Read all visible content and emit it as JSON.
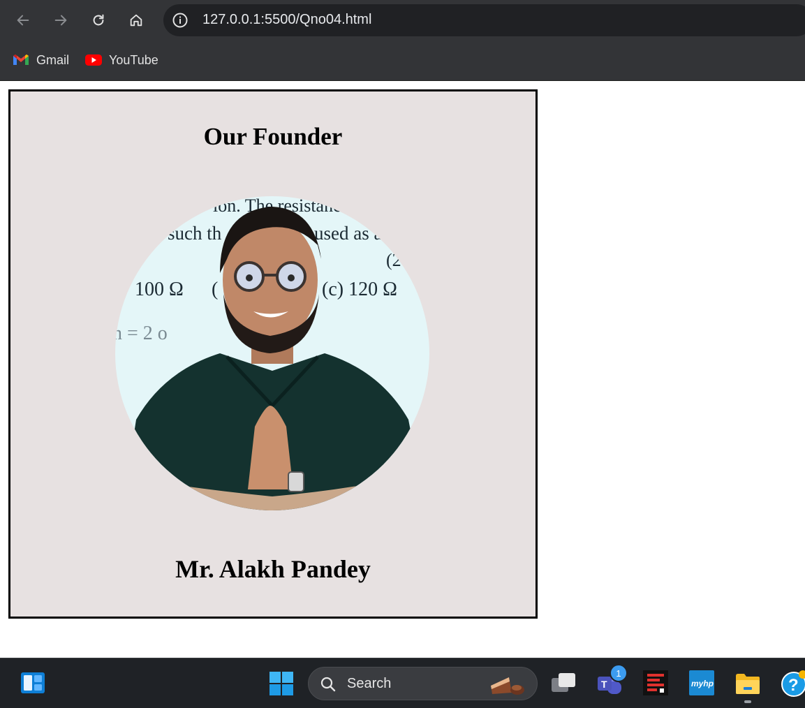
{
  "browser": {
    "url": "127.0.0.1:5500/Qno04.html",
    "bookmarks": [
      {
        "label": "Gmail",
        "icon": "gmail-icon"
      },
      {
        "label": "YouTube",
        "icon": "youtube-icon"
      }
    ]
  },
  "page": {
    "title": "Our Founder",
    "name": "Mr. Alakh Pandey",
    "photo_text": {
      "line1": "ion. The resistance",
      "line2": "such th",
      "line3": "used as a",
      "mark": "(2",
      "option_a": "100 Ω",
      "option_b": "(",
      "option_c": "(c)  120 Ω",
      "formula": "n = 2 o"
    }
  },
  "taskbar": {
    "search_label": "Search",
    "teams_badge": "1",
    "icons": [
      "widgets-icon",
      "windows-start-icon",
      "search-icon",
      "task-view-icon",
      "teams-icon",
      "app-icon",
      "myhp-icon",
      "file-explorer-icon",
      "help-icon"
    ],
    "myhp_text": "myhp"
  },
  "colors": {
    "chrome": "#333437",
    "card_bg": "#e7e1e1",
    "taskbar": "#1f2226"
  }
}
